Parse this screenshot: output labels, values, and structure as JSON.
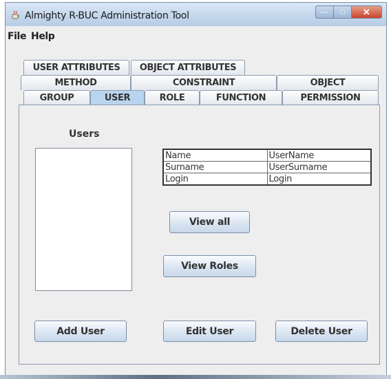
{
  "window": {
    "title": "Almighty R-BUC Administration Tool",
    "min_glyph": "—",
    "max_glyph": "□",
    "close_glyph": "✕"
  },
  "menu": [
    "File",
    "Help"
  ],
  "tabs": {
    "row1": [
      "USER ATTRIBUTES",
      "OBJECT ATTRIBUTES"
    ],
    "row2": [
      "METHOD",
      "CONSTRAINT",
      "OBJECT"
    ],
    "row3": [
      "GROUP",
      "USER",
      "ROLE",
      "FUNCTION",
      "PERMISSION"
    ],
    "selected": "USER"
  },
  "users_panel": {
    "label": "Users",
    "details": [
      {
        "field": "Name",
        "value": "UserName"
      },
      {
        "field": "Surname",
        "value": "UserSurname"
      },
      {
        "field": "Login",
        "value": "Login"
      }
    ],
    "buttons": {
      "view_all": "View all",
      "view_roles": "View Roles",
      "add_user": "Add User",
      "edit_user": "Edit User",
      "delete_user": "Delete User"
    }
  },
  "colors": {
    "selected_tab": "#b9d4ee",
    "window_bg": "#eeeeee",
    "close_button": "#c9452a"
  }
}
